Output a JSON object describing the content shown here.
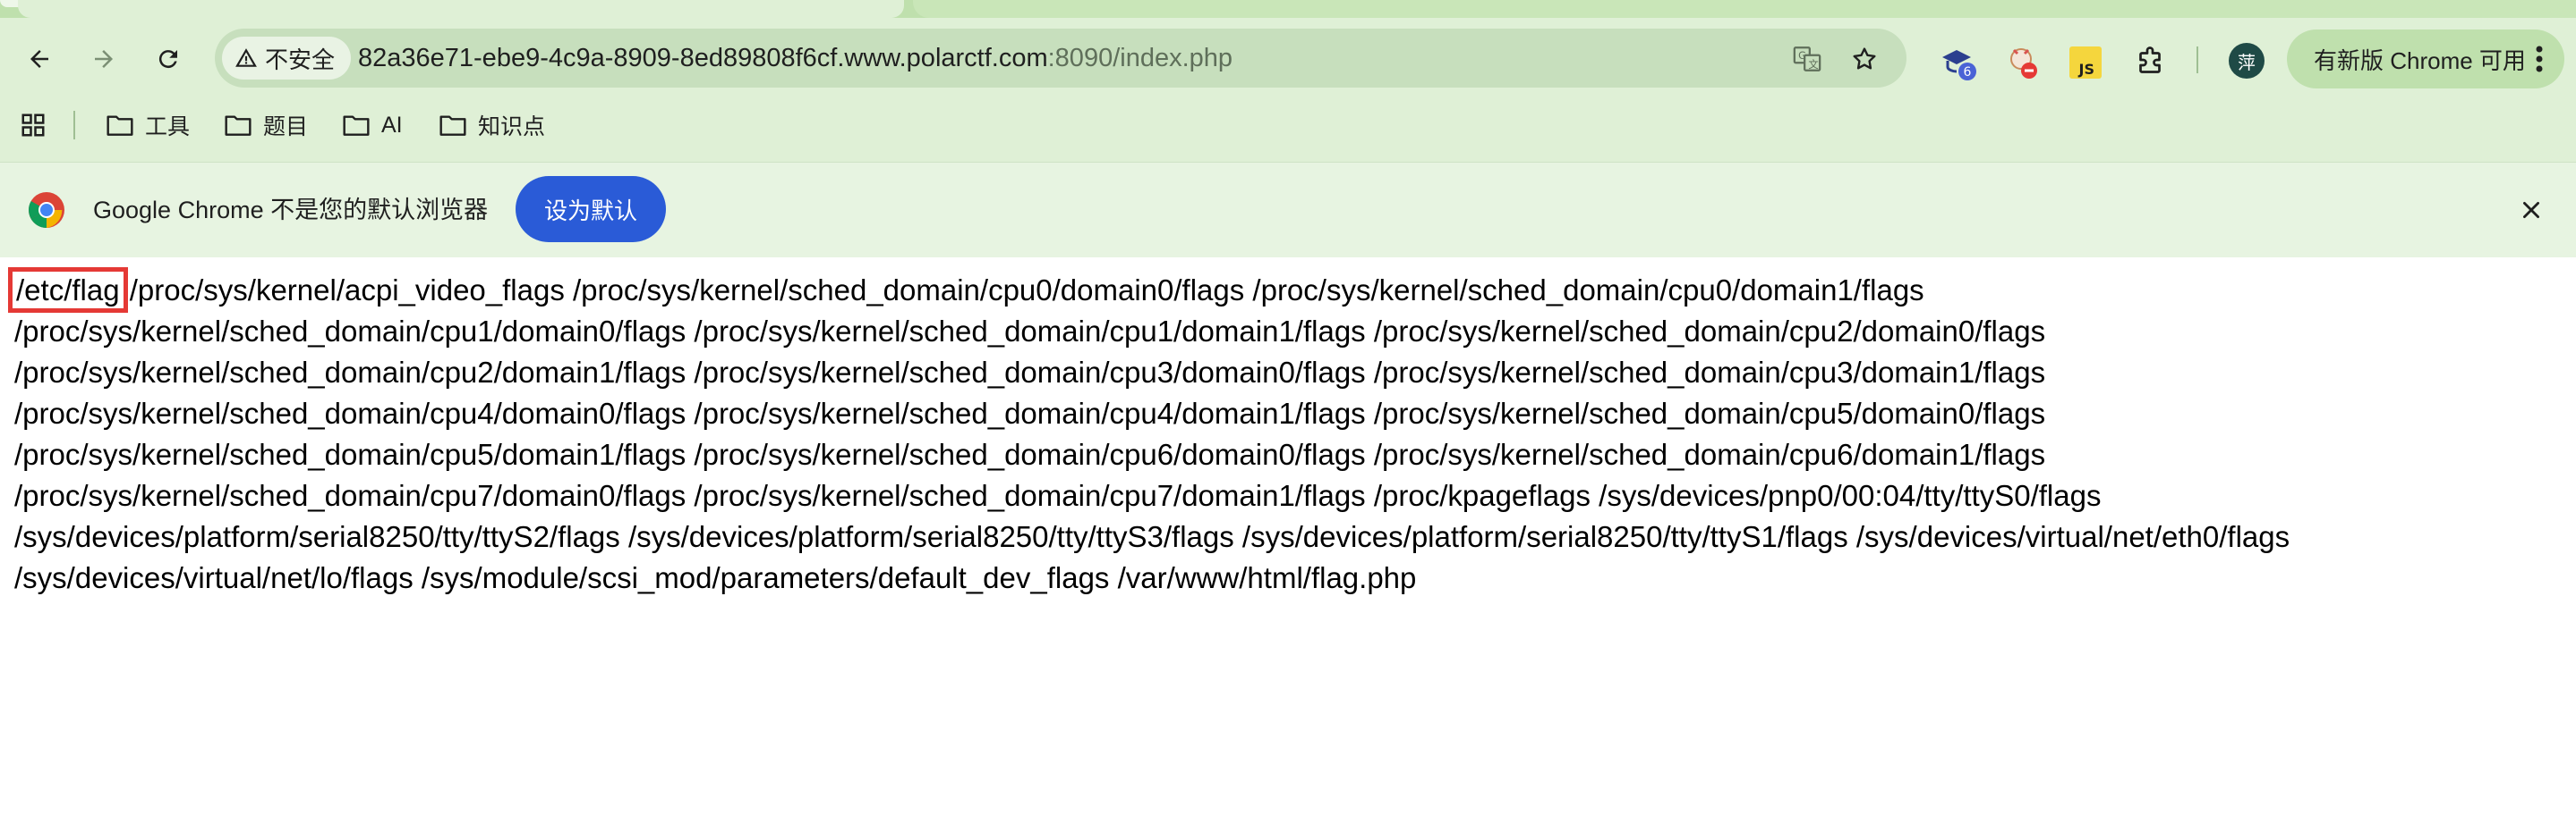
{
  "browser": {
    "tab_bar": {
      "active_tab_title": "",
      "inactive_tab_title": ""
    },
    "toolbar": {
      "back_icon": "arrow-left-icon",
      "forward_icon": "arrow-right-icon",
      "reload_icon": "reload-icon",
      "security_label": "不安全",
      "url_host": "82a36e71-ebe9-4c9a-8909-8ed89808f6cf.www.polarctf.com",
      "url_rest": ":8090/index.php",
      "translate_icon": "translate-icon",
      "bookmark_icon": "star-icon",
      "extension_badge_count": "6",
      "profile_initial": "萍",
      "update_label": "有新版 Chrome 可用"
    },
    "bookmarks_bar": {
      "items": [
        {
          "label": "工具",
          "icon": "folder-icon"
        },
        {
          "label": "题目",
          "icon": "folder-icon"
        },
        {
          "label": "AI",
          "icon": "folder-icon"
        },
        {
          "label": "知识点",
          "icon": "folder-icon"
        }
      ]
    },
    "infobar": {
      "message": "Google Chrome 不是您的默认浏览器",
      "button_label": "设为默认",
      "close_icon": "close-icon"
    },
    "colors": {
      "frame": "#dff0d6",
      "omnibox": "#c7dfbd",
      "primary_button": "#2a5bd7",
      "highlight_border": "#e53935"
    }
  },
  "page": {
    "highlighted_path": "/etc/flag",
    "lines": [
      " /proc/sys/kernel/acpi_video_flags /proc/sys/kernel/sched_domain/cpu0/domain0/flags /proc/sys/kernel/sched_domain/cpu0/domain1/flags",
      "/proc/sys/kernel/sched_domain/cpu1/domain0/flags /proc/sys/kernel/sched_domain/cpu1/domain1/flags /proc/sys/kernel/sched_domain/cpu2/domain0/flags",
      "/proc/sys/kernel/sched_domain/cpu2/domain1/flags /proc/sys/kernel/sched_domain/cpu3/domain0/flags /proc/sys/kernel/sched_domain/cpu3/domain1/flags",
      "/proc/sys/kernel/sched_domain/cpu4/domain0/flags /proc/sys/kernel/sched_domain/cpu4/domain1/flags /proc/sys/kernel/sched_domain/cpu5/domain0/flags",
      "/proc/sys/kernel/sched_domain/cpu5/domain1/flags /proc/sys/kernel/sched_domain/cpu6/domain0/flags /proc/sys/kernel/sched_domain/cpu6/domain1/flags",
      "/proc/sys/kernel/sched_domain/cpu7/domain0/flags /proc/sys/kernel/sched_domain/cpu7/domain1/flags /proc/kpageflags /sys/devices/pnp0/00:04/tty/ttyS0/flags",
      "/sys/devices/platform/serial8250/tty/ttyS2/flags /sys/devices/platform/serial8250/tty/ttyS3/flags /sys/devices/platform/serial8250/tty/ttyS1/flags /sys/devices/virtual/net/eth0/flags",
      "/sys/devices/virtual/net/lo/flags /sys/module/scsi_mod/parameters/default_dev_flags /var/www/html/flag.php"
    ]
  }
}
